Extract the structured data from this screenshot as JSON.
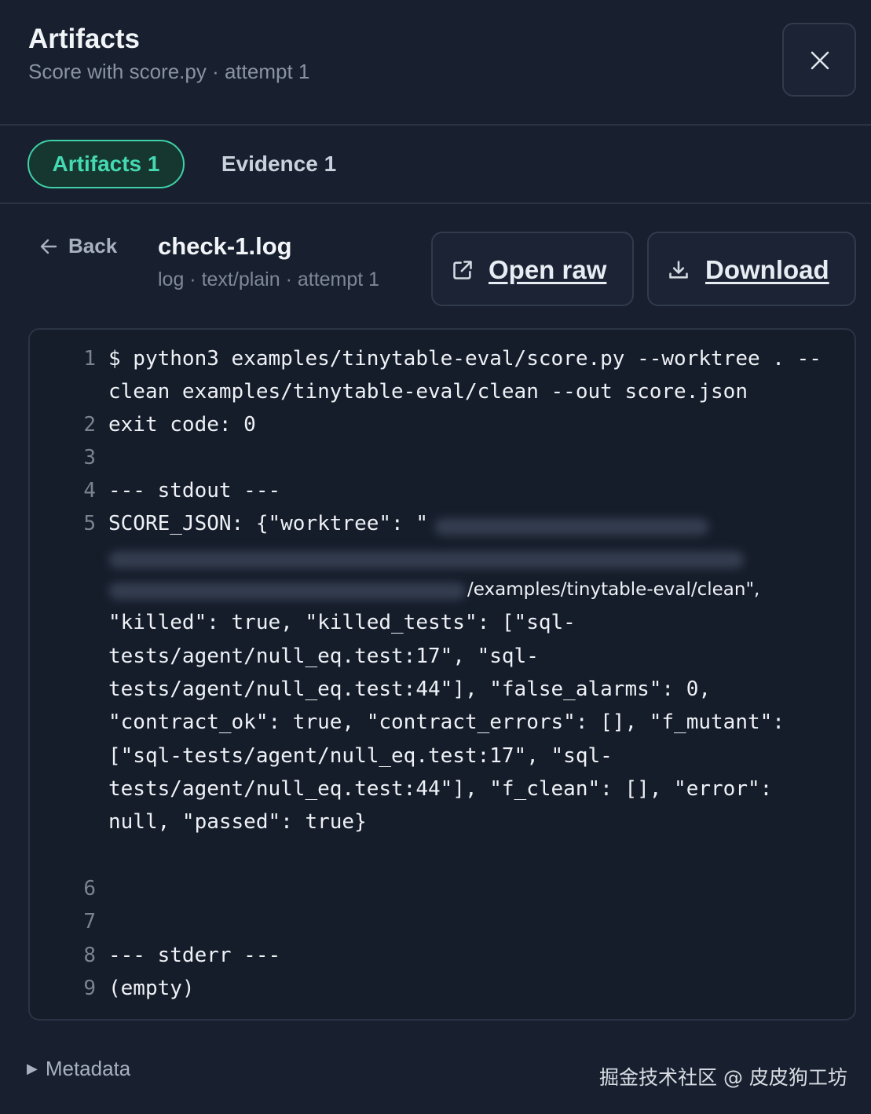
{
  "header": {
    "title": "Artifacts",
    "subtitle": "Score with score.py · attempt 1"
  },
  "tabs": [
    {
      "label": "Artifacts 1",
      "active": true
    },
    {
      "label": "Evidence 1",
      "active": false
    }
  ],
  "file": {
    "back_label": "Back",
    "name": "check-1.log",
    "meta": "log · text/plain · attempt 1",
    "open_raw_label": "Open raw",
    "download_label": "Download"
  },
  "log": {
    "numbers": [
      "1",
      "2",
      "3",
      "4",
      "5",
      "6",
      "7",
      "8",
      "9"
    ],
    "lines": [
      "$ python3 examples/tinytable-eval/score.py --worktree . --",
      "clean examples/tinytable-eval/clean --out score.json",
      "exit code: 0",
      "--- stdout ---",
      "SCORE_JSON: {\"worktree\": \"",
      "/examples/tinytable-eval/clean\",",
      "\"killed\": true, \"killed_tests\": [\"sql-",
      "tests/agent/null_eq.test:17\", \"sql-",
      "tests/agent/null_eq.test:44\"], \"false_alarms\": 0,",
      "\"contract_ok\": true, \"contract_errors\": [], \"f_mutant\":",
      "[\"sql-tests/agent/null_eq.test:17\", \"sql-",
      "tests/agent/null_eq.test:44\"], \"f_clean\": [], \"error\":",
      "null, \"passed\": true}",
      "--- stderr ---",
      "(empty)"
    ]
  },
  "footer": {
    "metadata_label": "Metadata",
    "watermark": "掘金技术社区 @ 皮皮狗工坊"
  },
  "colors": {
    "background": "#182030",
    "accent": "#44d9b2",
    "code_background": "#151c2a"
  },
  "icons": [
    "close-icon",
    "arrow-left-icon",
    "external-link-icon",
    "download-icon",
    "caret-right-icon"
  ]
}
